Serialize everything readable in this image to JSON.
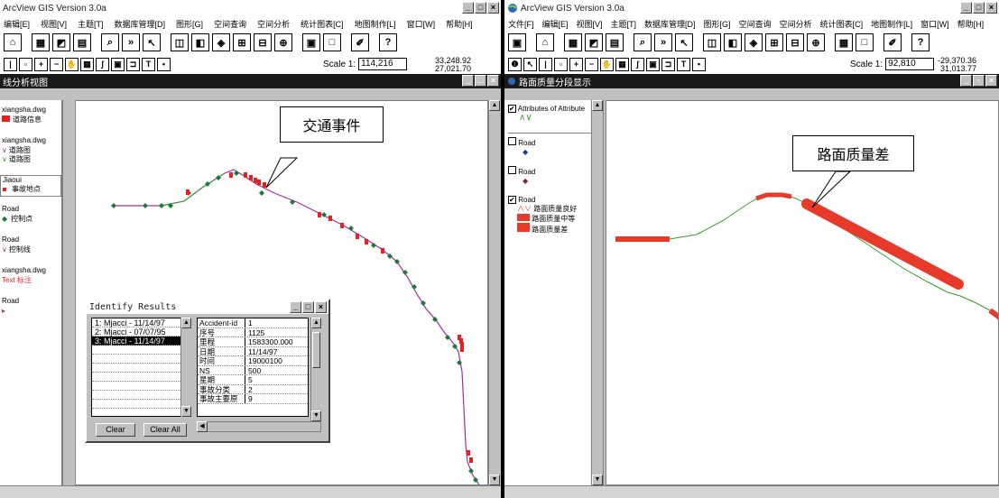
{
  "left": {
    "title": "ArcView GIS Version 3.0a",
    "menus": [
      "编辑[E]",
      "视图[V]",
      "主题[T]",
      "数据库管理[D]",
      "图形[G]",
      "空间查询",
      "空间分析",
      "统计图表[C]",
      "地图制作[L]",
      "窗口[W]",
      "帮助[H]"
    ],
    "scale_label": "Scale 1:",
    "scale_value": "114,216",
    "coord_x": "33,248.92",
    "coord_y": "27,021.70",
    "view_title": "线分析视图",
    "toc": [
      {
        "name": "xiangsha.dwg",
        "legend": "道路信息"
      },
      {
        "name": "xiangsha.dwg",
        "legend": "道路图"
      },
      {
        "name": "",
        "legend": "道路图"
      },
      {
        "name": "Jiaoui",
        "legend": "事故地点"
      },
      {
        "name": "Road",
        "legend": "控制点"
      },
      {
        "name": "Road",
        "legend": "控制线"
      },
      {
        "name": "xiangsha.dwg",
        "legend": "Text 标注"
      },
      {
        "name": "Road",
        "legend": ""
      }
    ],
    "callout": "交通事件"
  },
  "identify": {
    "title": "Identify Results",
    "items": [
      "1: Mjacci - 11/14/97",
      "2: Mjacci - 07/07/95",
      "3: Mjacci - 11/14/97"
    ],
    "selected_index": 2,
    "attributes": [
      {
        "k": "Accident-id",
        "v": "1"
      },
      {
        "k": "序号",
        "v": "1125"
      },
      {
        "k": "里程",
        "v": "1583300.000"
      },
      {
        "k": "日期",
        "v": "11/14/97"
      },
      {
        "k": "时间",
        "v": "19000100"
      },
      {
        "k": "NS",
        "v": "500"
      },
      {
        "k": "星期",
        "v": "5"
      },
      {
        "k": "事故分类",
        "v": "2"
      },
      {
        "k": "事故主要原",
        "v": "9"
      }
    ],
    "clear_label": "Clear",
    "clear_all_label": "Clear All"
  },
  "right": {
    "title": "ArcView GIS Version 3.0a",
    "menus": [
      "文件[F]",
      "编辑[E]",
      "视图[V]",
      "主题[T]",
      "数据库管理[D]",
      "图形[G]",
      "空间查询",
      "空间分析",
      "统计图表[C]",
      "地图制作[L]",
      "窗口[W]",
      "帮助[H]"
    ],
    "scale_label": "Scale 1:",
    "scale_value": "92,810",
    "coord_x": "-29,370.36",
    "coord_y": "31,013.77",
    "view_title": "路面质量分段显示",
    "toc": [
      {
        "name": "Attributes of Attribute",
        "checked": true
      },
      {
        "name": "Road",
        "checked": false
      },
      {
        "name": "Road",
        "checked": false
      },
      {
        "name": "Road",
        "checked": true
      }
    ],
    "legend": [
      "路面质量良好",
      "路面质量中等",
      "路面质量差"
    ],
    "callout": "路面质量差"
  },
  "colors": {
    "road": "#a0309a",
    "road_green": "#3a9a2a",
    "accident": "#e82020",
    "control": "#1a7a3a",
    "poor": "#e83a2a"
  }
}
